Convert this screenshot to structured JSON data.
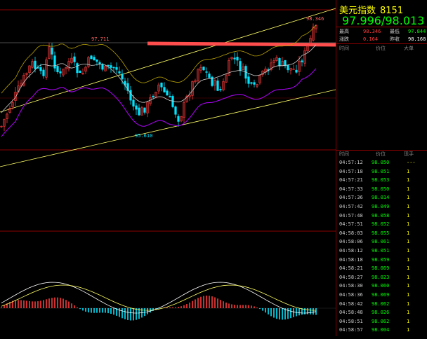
{
  "header": {
    "title": "美元指数",
    "code": "8151",
    "bid_ask": "97.996/98.013"
  },
  "quote": {
    "high_label": "最高",
    "high_value": "98.346",
    "low_label": "最低",
    "low_value": "97.844",
    "change_label": "涨跌",
    "change_value": "0.164",
    "prev_close_label": "昨收",
    "prev_close_value": "98.168"
  },
  "upper_table_header": {
    "time": "时间",
    "price": "价位",
    "volume": "大单"
  },
  "lower_table_header": {
    "time": "时间",
    "price": "价位",
    "volume": "现手"
  },
  "ticks": [
    {
      "time": "04:57:12",
      "price": "98.050",
      "vol": "---"
    },
    {
      "time": "04:57:18",
      "price": "98.051",
      "vol": "1"
    },
    {
      "time": "04:57:21",
      "price": "98.053",
      "vol": "1"
    },
    {
      "time": "04:57:33",
      "price": "98.050",
      "vol": "1"
    },
    {
      "time": "04:57:36",
      "price": "98.014",
      "vol": "1"
    },
    {
      "time": "04:57:42",
      "price": "98.049",
      "vol": "1"
    },
    {
      "time": "04:57:48",
      "price": "98.058",
      "vol": "1"
    },
    {
      "time": "04:57:51",
      "price": "98.052",
      "vol": "1"
    },
    {
      "time": "04:58:03",
      "price": "98.055",
      "vol": "1"
    },
    {
      "time": "04:58:06",
      "price": "98.061",
      "vol": "1"
    },
    {
      "time": "04:58:12",
      "price": "98.051",
      "vol": "1"
    },
    {
      "time": "04:58:18",
      "price": "98.059",
      "vol": "1"
    },
    {
      "time": "04:58:21",
      "price": "98.069",
      "vol": "1"
    },
    {
      "time": "04:58:27",
      "price": "98.023",
      "vol": "1"
    },
    {
      "time": "04:58:30",
      "price": "98.060",
      "vol": "1"
    },
    {
      "time": "04:58:36",
      "price": "98.069",
      "vol": "1"
    },
    {
      "time": "04:58:42",
      "price": "98.062",
      "vol": "1"
    },
    {
      "time": "04:58:48",
      "price": "98.026",
      "vol": "1"
    },
    {
      "time": "04:58:51",
      "price": "98.062",
      "vol": "1"
    },
    {
      "time": "04:58:57",
      "price": "98.004",
      "vol": "1"
    }
  ],
  "chart_labels": {
    "peak_high": "98.346",
    "resistance": "97.711",
    "swing_low": "95.610"
  },
  "colors": {
    "up_candle": "#ff3b3b",
    "down_candle": "#00e5ff",
    "trendline": "#ffff66",
    "resistance": "#ff4d4d",
    "lower_band": "#b000ff",
    "frame": "#8b0000"
  }
}
